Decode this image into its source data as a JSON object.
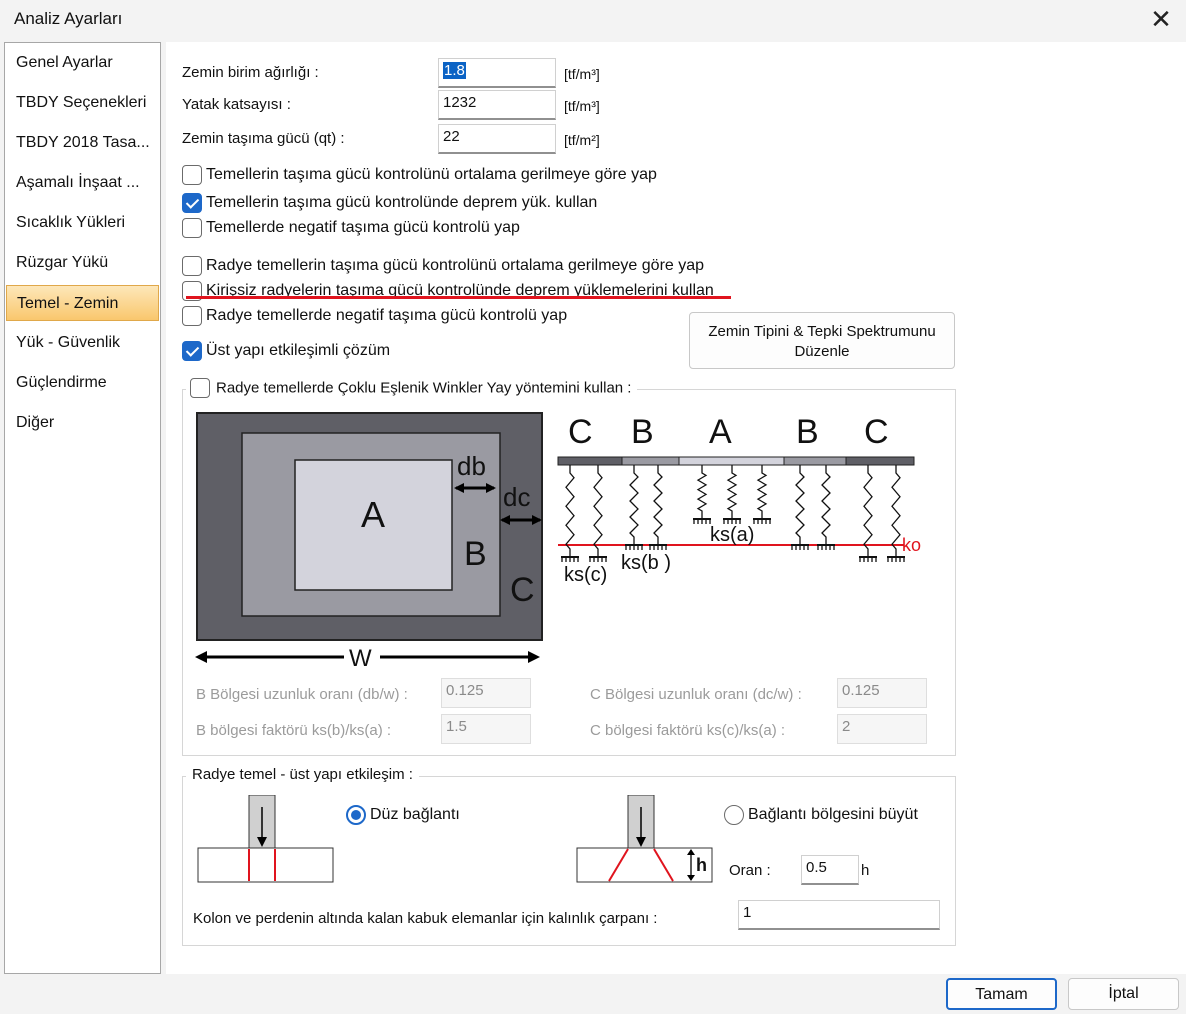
{
  "window": {
    "title": "Analiz Ayarları"
  },
  "sidebar": {
    "items": [
      {
        "label": "Genel Ayarlar"
      },
      {
        "label": "TBDY Seçenekleri"
      },
      {
        "label": "TBDY 2018 Tasa..."
      },
      {
        "label": "Aşamalı İnşaat ..."
      },
      {
        "label": "Sıcaklık Yükleri"
      },
      {
        "label": "Rüzgar Yükü"
      },
      {
        "label": "Temel - Zemin"
      },
      {
        "label": "Yük - Güvenlik"
      },
      {
        "label": "Güçlendirme"
      },
      {
        "label": "Diğer"
      }
    ],
    "active_index": 6
  },
  "soil": {
    "unit_weight": {
      "label": "Zemin birim ağırlığı :",
      "value": "1.8",
      "unit": "[tf/m³]"
    },
    "bed_coefficient": {
      "label": "Yatak katsayısı :",
      "value": "1232",
      "unit": "[tf/m³]"
    },
    "bearing_capacity": {
      "label": "Zemin taşıma gücü (qt) :",
      "value": "22",
      "unit": "[tf/m²]"
    }
  },
  "options": [
    {
      "label": "Temellerin taşıma gücü kontrolünü ortalama gerilmeye göre yap",
      "checked": false
    },
    {
      "label": "Temellerin taşıma gücü kontrolünde deprem yük. kullan",
      "checked": true
    },
    {
      "label": "Temellerde negatif taşıma gücü kontrolü yap",
      "checked": false
    },
    {
      "label": "Radye temellerin taşıma gücü kontrolünü ortalama gerilmeye göre yap",
      "checked": false
    },
    {
      "label": "Kirişsiz radyelerin taşıma gücü kontrolünde deprem yüklemelerini kullan",
      "checked": false
    },
    {
      "label": "Radye temellerde negatif taşıma gücü kontrolü yap",
      "checked": false
    },
    {
      "label": "Üst yapı etkileşimli çözüm",
      "checked": true
    }
  ],
  "spectrum_button": {
    "line1": "Zemin Tipini  & Tepki Spektrumunu",
    "line2": "Düzenle"
  },
  "winkler": {
    "label": "Radye temellerde Çoklu Eşlenik Winkler Yay yöntemini kullan :",
    "checked": false,
    "diagram": {
      "plan_labels": {
        "a": "A",
        "b": "B",
        "c": "C",
        "db": "db",
        "dc": "dc",
        "w": "W"
      },
      "section_labels": [
        "C",
        "B",
        "A",
        "B",
        "C"
      ],
      "spring_labels": {
        "ksa": "ks(a)",
        "ksb": "ks(b )",
        "ksc": "ks(c)",
        "ko": "ko"
      }
    },
    "b_length_ratio": {
      "label": "B Bölgesi uzunluk oranı (db/w) :",
      "value": "0.125"
    },
    "c_length_ratio": {
      "label": "C Bölgesi uzunluk oranı (dc/w) :",
      "value": "0.125"
    },
    "b_factor": {
      "label": "B bölgesi faktörü ks(b)/ks(a) :",
      "value": "1.5"
    },
    "c_factor": {
      "label": "C bölgesi faktörü ks(c)/ks(a) :",
      "value": "2"
    }
  },
  "interaction": {
    "legend": "Radye temel - üst yapı etkileşim :",
    "flat": {
      "label": "Düz bağlantı",
      "selected": true
    },
    "enlarge": {
      "label": "Bağlantı bölgesini büyüt",
      "selected": false
    },
    "ratio": {
      "label": "Oran :",
      "value": "0.5",
      "suffix": "h"
    },
    "h_label": "h",
    "thickness": {
      "label": "Kolon ve perdenin altında kalan kabuk elemanlar için kalınlık çarpanı :",
      "value": "1"
    }
  },
  "buttons": {
    "ok": "Tamam",
    "cancel": "İptal"
  },
  "colors": {
    "accent": "#1d68c9",
    "active_nav": "#f9c76d",
    "highlight_line": "#e0141e"
  }
}
